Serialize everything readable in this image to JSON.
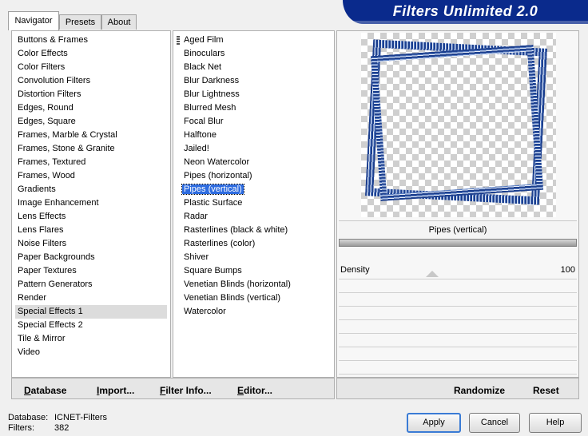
{
  "window": {
    "title": "Filters Unlimited 2.0"
  },
  "tabs": [
    {
      "label": "Navigator",
      "active": true
    },
    {
      "label": "Presets",
      "active": false
    },
    {
      "label": "About",
      "active": false
    }
  ],
  "categories": [
    "Buttons & Frames",
    "Color Effects",
    "Color Filters",
    "Convolution Filters",
    "Distortion Filters",
    "Edges, Round",
    "Edges, Square",
    "Frames, Marble & Crystal",
    "Frames, Stone & Granite",
    "Frames, Textured",
    "Frames, Wood",
    "Gradients",
    "Image Enhancement",
    "Lens Effects",
    "Lens Flares",
    "Noise Filters",
    "Paper Backgrounds",
    "Paper Textures",
    "Pattern Generators",
    "Render",
    "Special Effects 1",
    "Special Effects 2",
    "Tile & Mirror",
    "Video"
  ],
  "selected_category": "Special Effects 1",
  "filters": [
    "Aged Film",
    "Binoculars",
    "Black Net",
    "Blur Darkness",
    "Blur Lightness",
    "Blurred Mesh",
    "Focal Blur",
    "Halftone",
    "Jailed!",
    "Neon Watercolor",
    "Pipes (horizontal)",
    "Pipes (vertical)",
    "Plastic Surface",
    "Radar",
    "Rasterlines (black & white)",
    "Rasterlines (color)",
    "Shiver",
    "Square Bumps",
    "Venetian Blinds (horizontal)",
    "Venetian Blinds (vertical)",
    "Watercolor"
  ],
  "selected_filter": "Pipes (vertical)",
  "preview": {
    "filter_name": "Pipes (vertical)",
    "params": [
      {
        "label": "Density",
        "value": "100"
      }
    ]
  },
  "left_toolbar": {
    "database": "Database",
    "import": "Import...",
    "filter_info": "Filter Info...",
    "editor": "Editor..."
  },
  "right_toolbar": {
    "randomize": "Randomize",
    "reset": "Reset"
  },
  "status": {
    "database_label": "Database:",
    "database_value": "ICNET-Filters",
    "filters_label": "Filters:",
    "filters_value": "382"
  },
  "buttons": {
    "apply": "Apply",
    "cancel": "Cancel",
    "help": "Help"
  },
  "colors": {
    "banner": "#0a2a8c",
    "selection": "#2e6ce0"
  }
}
